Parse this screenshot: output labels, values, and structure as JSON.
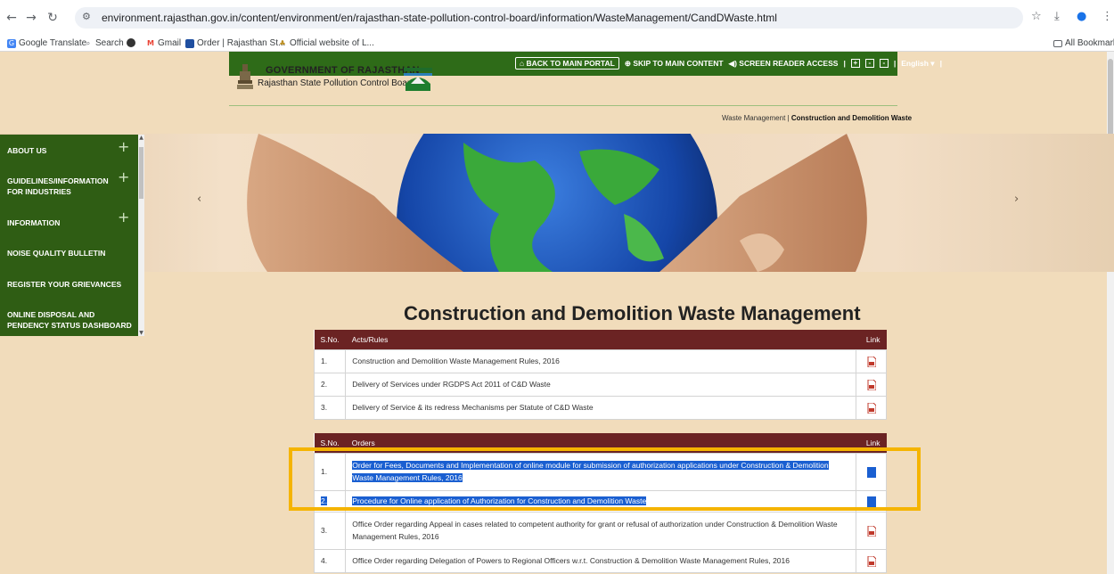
{
  "browser": {
    "url": "environment.rajasthan.gov.in/content/environment/en/rajasthan-state-pollution-control-board/information/WasteManagement/CandDWaste.html",
    "bookmarks": [
      "Google Translate",
      "Search",
      "Gmail",
      "Order | Rajasthan St...",
      "Official website of L..."
    ],
    "all_bookmarks": "All Bookmarks"
  },
  "header": {
    "gov_title": "GOVERNMENT OF RAJASTHAN",
    "board": "Rajasthan State Pollution Control Board",
    "back": "BACK TO MAIN PORTAL",
    "skip": "SKIP TO MAIN CONTENT",
    "reader": "SCREEN READER ACCESS",
    "font_plus": "+",
    "font_normal": "-",
    "font_minus": "-",
    "language": "English"
  },
  "breadcrumb": {
    "parent": "Waste Management",
    "current": "Construction and Demolition Waste"
  },
  "sidebar": {
    "items": [
      {
        "label": "ABOUT US"
      },
      {
        "label": "GUIDELINES/INFORMATION FOR INDUSTRIES"
      },
      {
        "label": "INFORMATION"
      },
      {
        "label": "NOISE QUALITY BULLETIN"
      },
      {
        "label": "REGISTER YOUR GRIEVANCES"
      },
      {
        "label": "ONLINE DISPOSAL AND PENDENCY STATUS DASHBOARD"
      }
    ]
  },
  "main": {
    "title": "Construction and Demolition Waste Management",
    "acts": {
      "headers": [
        "S.No.",
        "Acts/Rules",
        "Link"
      ],
      "rows": [
        {
          "sn": "1.",
          "text": "Construction and Demolition Waste Management Rules, 2016"
        },
        {
          "sn": "2.",
          "text": "Delivery of Services under RGDPS Act 2011 of C&D Waste"
        },
        {
          "sn": "3.",
          "text": "Delivery of Service & its redress Mechanisms per Statute of C&D Waste"
        }
      ]
    },
    "orders": {
      "headers": [
        "S.No.",
        "Orders",
        "Link"
      ],
      "rows": [
        {
          "sn": "1.",
          "text": "Order for Fees, Documents and Implementation of online module for submission of authorization applications under Construction & Demolition Waste Management Rules, 2016"
        },
        {
          "sn": "2.",
          "text": "Procedure for Online application of Authorization for Construction and Demolition Waste"
        },
        {
          "sn": "3.",
          "text": "Office Order regarding Appeal in cases related to competent authority for grant or refusal of authorization under Construction & Demolition Waste Management Rules, 2016"
        },
        {
          "sn": "4.",
          "text": "Office Order regarding Delegation of Powers to Regional Officers w.r.t. Construction & Demolition Waste Management Rules, 2016"
        }
      ]
    }
  }
}
